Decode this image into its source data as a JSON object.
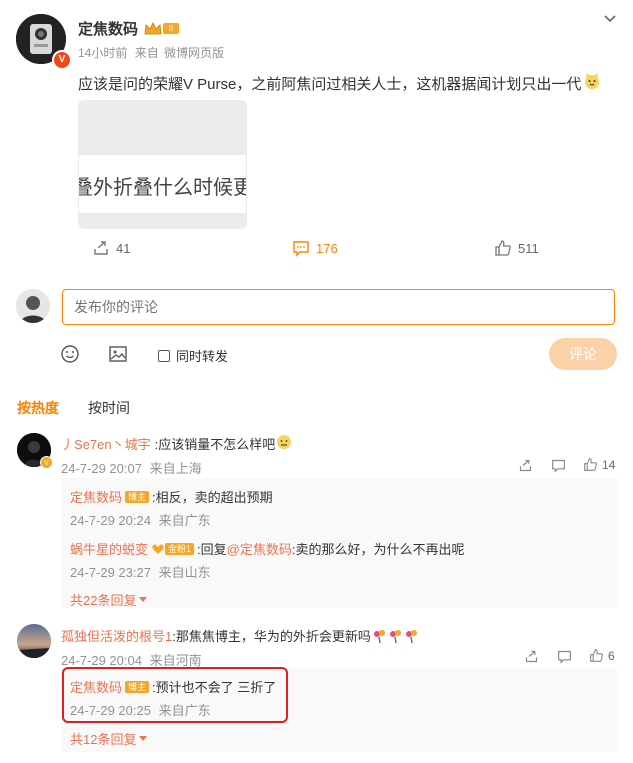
{
  "post": {
    "author": "定焦数码",
    "time": "14小时前",
    "source_prefix": "来自",
    "source": "微博网页版",
    "text": "应该是问的荣耀V Purse，之前阿焦问过相关人士，这机器据闻计划只出一代",
    "image_text": "叠外折叠什么时候更新",
    "actions": {
      "repost": "41",
      "comment": "176",
      "like": "511"
    }
  },
  "composer": {
    "placeholder": "发布你的评论",
    "sync_label": "同时转发",
    "submit_label": "评论"
  },
  "sort": {
    "hot": "按热度",
    "time": "按时间"
  },
  "comments": [
    {
      "author": "丿Se7en丶城宇",
      "text": ":应该销量不怎么样吧",
      "time": "24-7-29 20:07",
      "source": "来自上海",
      "likes": "14",
      "replies": [
        {
          "author": "定焦数码",
          "badge": "博主",
          "text": ":相反，卖的超出预期",
          "time": "24-7-29 20:24",
          "source": "来自广东"
        },
        {
          "author": "蜗牛星的蜕变",
          "badge": "金粉1",
          "text_prefix": ":回复",
          "mention": "@定焦数码",
          "text": ":卖的那么好，为什么不再出呢",
          "time": "24-7-29 23:27",
          "source": "来自山东"
        }
      ],
      "more": "共22条回复"
    },
    {
      "author": "孤独但活泼的根号1",
      "text": ":那焦焦博主，华为的外折会更新吗",
      "time": "24-7-29 20:04",
      "source": "来自河南",
      "likes": "6",
      "replies": [
        {
          "author": "定焦数码",
          "badge": "博主",
          "text": ":预计也不会了 三折了",
          "time": "24-7-29 20:25",
          "source": "来自广东"
        }
      ],
      "more": "共12条回复"
    }
  ],
  "colors": {
    "accent": "#ff8200",
    "link": "#eb7350",
    "highlight_box": "#e02020",
    "submit_disabled": "#fbd2a8"
  }
}
